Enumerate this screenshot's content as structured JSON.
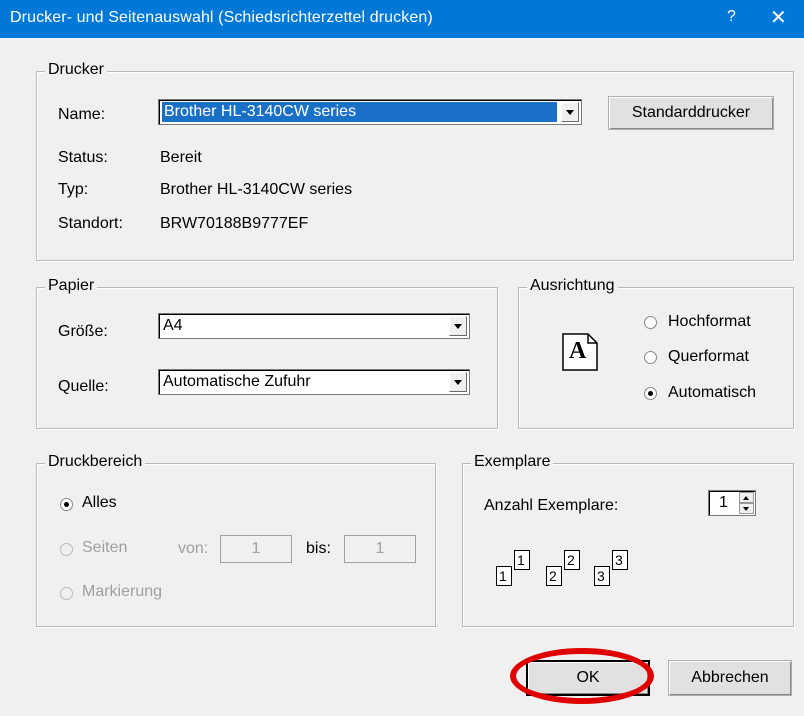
{
  "window": {
    "title": "Drucker- und Seitenauswahl (Schiedsrichterzettel drucken)",
    "help": "?",
    "close": "✕"
  },
  "printer": {
    "legend": "Drucker",
    "name_label": "Name:",
    "name_value": "Brother HL-3140CW series",
    "default_button": "Standarddrucker",
    "status_label": "Status:",
    "status_value": "Bereit",
    "type_label": "Typ:",
    "type_value": "Brother HL-3140CW series",
    "location_label": "Standort:",
    "location_value": "BRW70188B9777EF"
  },
  "paper": {
    "legend": "Papier",
    "size_label": "Größe:",
    "size_value": "A4",
    "source_label": "Quelle:",
    "source_value": "Automatische Zufuhr"
  },
  "orientation": {
    "legend": "Ausrichtung",
    "icon_letter": "A",
    "options": [
      "Hochformat",
      "Querformat",
      "Automatisch"
    ],
    "selected": "Automatisch"
  },
  "range": {
    "legend": "Druckbereich",
    "all": "Alles",
    "pages": "Seiten",
    "from_label": "von:",
    "from_value": "1",
    "to_label": "bis:",
    "to_value": "1",
    "selection": "Markierung"
  },
  "copies": {
    "legend": "Exemplare",
    "count_label": "Anzahl Exemplare:",
    "count_value": "1",
    "collate_pages": [
      "1",
      "1",
      "2",
      "2",
      "3",
      "3"
    ]
  },
  "buttons": {
    "ok": "OK",
    "cancel": "Abbrechen"
  }
}
